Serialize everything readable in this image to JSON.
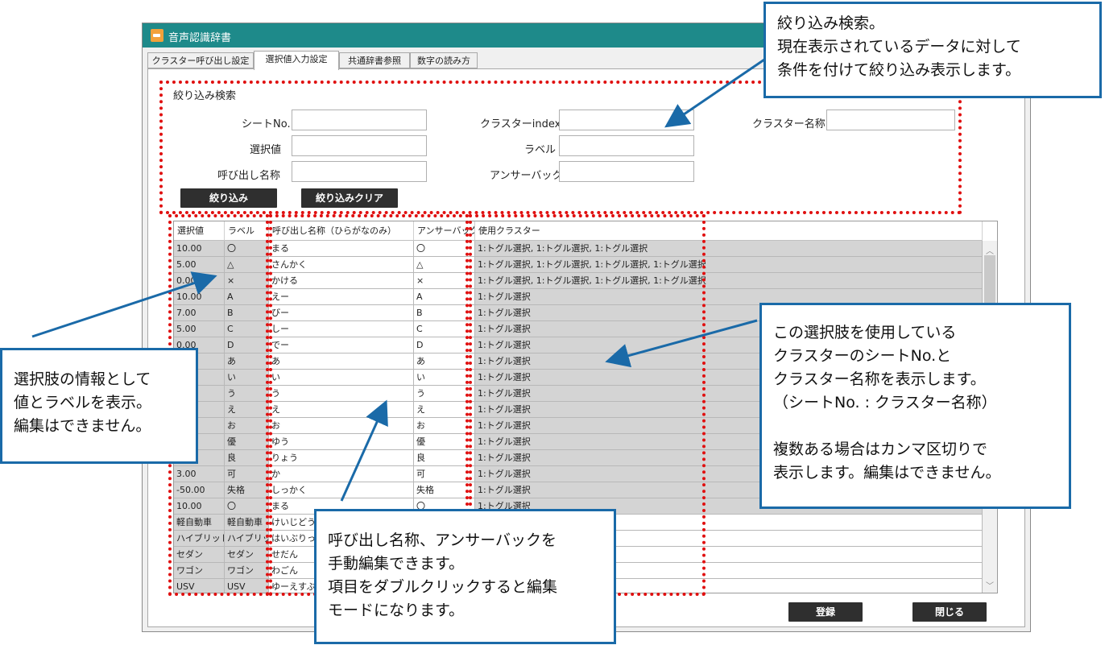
{
  "window": {
    "title": "音声認識辞書"
  },
  "tabs": [
    {
      "label": "クラスター呼び出し設定"
    },
    {
      "label": "選択値入力設定"
    },
    {
      "label": "共通辞書参照"
    },
    {
      "label": "数字の読み方"
    }
  ],
  "filter": {
    "section_label": "絞り込み検索",
    "fields": {
      "sheet_no": {
        "label": "シートNo.",
        "value": ""
      },
      "cluster_index": {
        "label": "クラスターindex",
        "value": ""
      },
      "cluster_name": {
        "label": "クラスター名称",
        "value": ""
      },
      "selection_value": {
        "label": "選択値",
        "value": ""
      },
      "label": {
        "label": "ラベル",
        "value": ""
      },
      "call_name": {
        "label": "呼び出し名称",
        "value": ""
      },
      "answerback": {
        "label": "アンサーバック",
        "value": ""
      }
    },
    "filter_button": "絞り込み",
    "clear_button": "絞り込みクリア"
  },
  "grid": {
    "headers": [
      "選択値",
      "ラベル",
      "呼び出し名称（ひらがなのみ）",
      "アンサーバック",
      "使用クラスター"
    ],
    "rows": [
      [
        "10.00",
        "〇",
        "まる",
        "〇",
        "1:トグル選択, 1:トグル選択, 1:トグル選択"
      ],
      [
        "5.00",
        "△",
        "さんかく",
        "△",
        "1:トグル選択, 1:トグル選択, 1:トグル選択, 1:トグル選択"
      ],
      [
        "0.00",
        "×",
        "かける",
        "×",
        "1:トグル選択, 1:トグル選択, 1:トグル選択, 1:トグル選択"
      ],
      [
        "10.00",
        "A",
        "えー",
        "A",
        "1:トグル選択"
      ],
      [
        "7.00",
        "B",
        "びー",
        "B",
        "1:トグル選択"
      ],
      [
        "5.00",
        "C",
        "しー",
        "C",
        "1:トグル選択"
      ],
      [
        "0.00",
        "D",
        "でー",
        "D",
        "1:トグル選択"
      ],
      [
        "",
        "あ",
        "あ",
        "あ",
        "1:トグル選択"
      ],
      [
        "",
        "い",
        "い",
        "い",
        "1:トグル選択"
      ],
      [
        "",
        "う",
        "う",
        "う",
        "1:トグル選択"
      ],
      [
        "",
        "え",
        "え",
        "え",
        "1:トグル選択"
      ],
      [
        "",
        "お",
        "お",
        "お",
        "1:トグル選択"
      ],
      [
        "",
        "優",
        "ゆう",
        "優",
        "1:トグル選択"
      ],
      [
        "5.00",
        "良",
        "りょう",
        "良",
        "1:トグル選択"
      ],
      [
        "3.00",
        "可",
        "か",
        "可",
        "1:トグル選択"
      ],
      [
        "-50.00",
        "失格",
        "しっかく",
        "失格",
        "1:トグル選択"
      ],
      [
        "10.00",
        "〇",
        "まる",
        "〇",
        "1:トグル選択"
      ],
      [
        "軽自動車",
        "軽自動車",
        "けいじどうしゃ",
        "",
        ""
      ],
      [
        "ハイブリッド",
        "ハイブリッド",
        "はいぶりっど",
        "",
        ""
      ],
      [
        "セダン",
        "セダン",
        "せだん",
        "",
        ""
      ],
      [
        "ワゴン",
        "ワゴン",
        "わごん",
        "",
        ""
      ],
      [
        "USV",
        "USV",
        "ゆーえすぶい",
        "",
        ""
      ]
    ]
  },
  "footer": {
    "register_button": "登録",
    "close_button": "閉じる"
  },
  "callouts": {
    "filter": [
      "絞り込み検索。",
      "現在表示されているデータに対して",
      "条件を付けて絞り込み表示します。"
    ],
    "choice": [
      "選択肢の情報として",
      "値とラベルを表示。",
      "編集はできません。"
    ],
    "cluster": [
      "この選択肢を使用している",
      "クラスターのシートNo.と",
      "クラスター名称を表示します。",
      "（シートNo. : クラスター名称）",
      "",
      "複数ある場合はカンマ区切りで",
      "表示します。編集はできません。"
    ],
    "edit": [
      "呼び出し名称、アンサーバックを",
      "手動編集できます。",
      "項目をダブルクリックすると編集",
      "モードになります。"
    ]
  },
  "colors": {
    "titlebar": "#1e8a8a",
    "callout_border": "#1a6aa8",
    "highlight": "#e01010",
    "button": "#2f2f2f"
  },
  "icons": {
    "app": "app-icon",
    "scroll_up": "chevron-up-icon",
    "scroll_down": "chevron-down-icon"
  }
}
